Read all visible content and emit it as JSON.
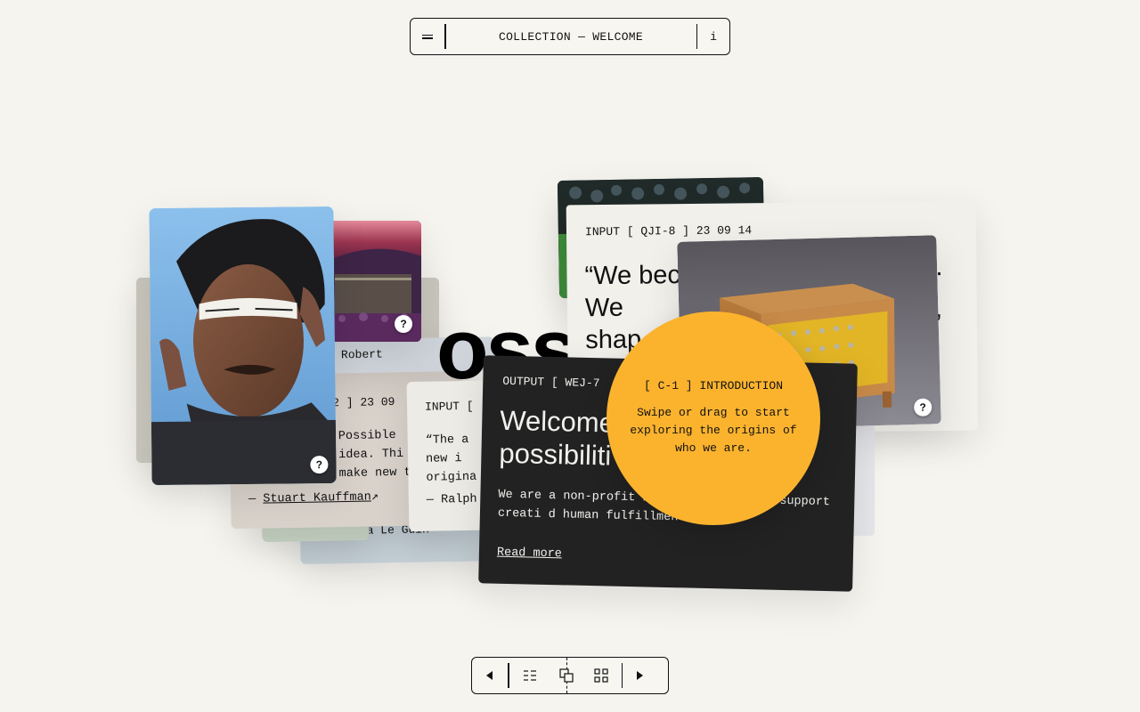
{
  "header": {
    "title": "COLLECTION — WELCOME",
    "info_label": "i"
  },
  "background": {
    "big_text": "oss"
  },
  "cards": {
    "kauffman": {
      "code": "2 ] 23 09",
      "text": "Possible idea. Thi make new t",
      "author": "Stuart Kauffman",
      "author_arrow": "↗"
    },
    "leguin": {
      "author_prefix": "—",
      "author": "Ursula Le Guin"
    },
    "robert": {
      "label": "Robert"
    },
    "ralph": {
      "header": "INPUT [",
      "text": "“The a new i origina",
      "author": "Ralph"
    },
    "qji8": {
      "code": "INPUT [ QJI-8 ] 23 09 14",
      "quote": "“We bec We shap there",
      "ending_dot": ".",
      "ending_quote": "”"
    },
    "wej7": {
      "code": "OUTPUT [ WEJ-7",
      "headline": "Welcome possibiliti",
      "body": "We are a non-profit nnology can better support creati d human fulfillment.",
      "read_more": "Read more"
    },
    "intro": {
      "label": "[ C-1 ] INTRODUCTION",
      "text": "Swipe or drag to start exploring the origins of who we are."
    }
  },
  "help_label": "?",
  "colors": {
    "background": "#f5f4ef",
    "dark_card": "#222222",
    "accent_circle": "#fbb32e",
    "kauffman_card": "#d9d2cb",
    "leguin_card": "#c4cfd6",
    "green_card": "#c6d2c3"
  },
  "icons": {
    "menu": "menu-icon",
    "prev": "triangle-left-icon",
    "list": "list-view-icon",
    "stack": "stack-view-icon",
    "grid": "grid-view-icon",
    "next": "triangle-right-icon"
  }
}
